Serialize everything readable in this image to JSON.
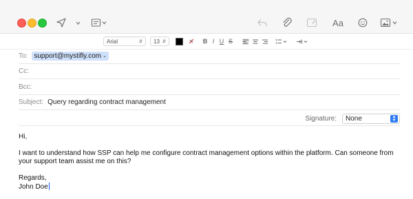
{
  "toolbar": {
    "window_controls": [
      "close-button",
      "minimize-button",
      "zoom-button"
    ],
    "icons": [
      "send-icon",
      "chevron-down-icon",
      "header-fields-icon",
      "reply-icon",
      "attachment-icon",
      "markup-icon",
      "format-text-icon",
      "emoji-icon",
      "photo-browser-icon"
    ],
    "format_label": "Aa"
  },
  "format_bar": {
    "font": "Arial",
    "size": "13",
    "bold": "B",
    "italic": "I",
    "underline": "U",
    "strike": "S"
  },
  "fields": {
    "to_label": "To:",
    "to_value": "support@mystifly.com",
    "cc_label": "Cc:",
    "bcc_label": "Bcc:",
    "subject_label": "Subject:",
    "subject_value": "Query regarding contract management"
  },
  "signature": {
    "label": "Signature:",
    "value": "None"
  },
  "message": {
    "greeting": "Hi,",
    "body": "I want to understand how SSP can help me configure contract management options within the platform. Can someone from your support team assist me on this?",
    "closing": "Regards,",
    "name": "John Doe"
  },
  "colors": {
    "recipient_token": "#cfe0fb",
    "accent": "#2f7bf5",
    "close": "#ff5f57",
    "minimize": "#febc2e",
    "zoom": "#28c840"
  }
}
